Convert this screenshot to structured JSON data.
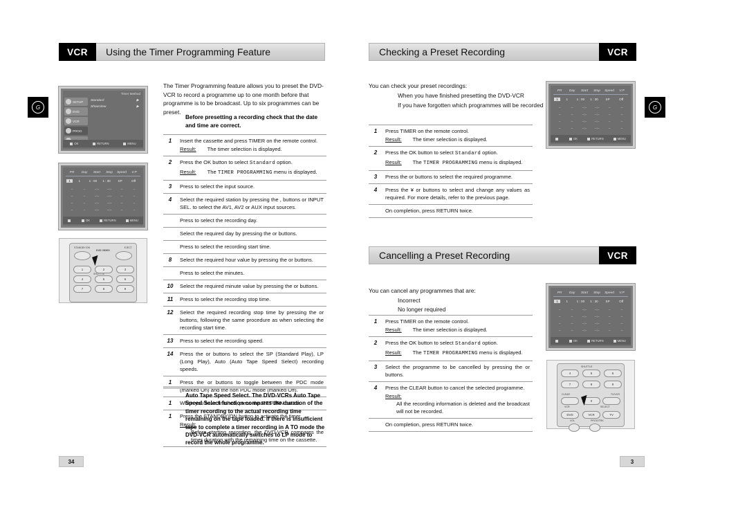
{
  "left_page": {
    "header": {
      "tag": "VCR",
      "title": "Using the Timer Programming Feature"
    },
    "intro": "The Timer Programming feature allows you to preset the DVD-VCR to record a programme up to one month before that programme is to be broadcast. Up to six programmes can be preset.",
    "note": "Before presetting a recording  check that the date and time are correct.",
    "steps": [
      {
        "num": "1",
        "text": "Insert the cassette and press TIMER on the remote control.",
        "result_label": "Result:",
        "result": "The timer selection is displayed."
      },
      {
        "num": "2",
        "text": "Press the OK button to select Standard option.",
        "mono_in_text": "Standard",
        "result_label": "Result:",
        "result": "The TIMER PROGRAMMING menu is displayed.",
        "mono_in_result": "TIMER PROGRAMMING"
      },
      {
        "num": "3",
        "text": "Press  to select the input source."
      },
      {
        "num": "4",
        "text": "Select the required station by pressing the  ,  buttons or INPUT SEL. to select the  AV1, AV2 or AUX input sources."
      },
      {
        "num": "",
        "text": "Press  to select the recording day."
      },
      {
        "num": "",
        "text": "Select the required day by pressing the  or  buttons."
      },
      {
        "num": "",
        "text": "Press  to select the recording start time."
      },
      {
        "num": "8",
        "text": "Select the required hour value by pressing the  or  buttons."
      },
      {
        "num": "",
        "text": "Press  to select the minutes."
      },
      {
        "num": "10",
        "text": "Select the required minute value by pressing the  or buttons."
      },
      {
        "num": "11",
        "text": "Press  to select the recording stop time."
      },
      {
        "num": "12",
        "text": "Select the required recording stop time by pressing the  or buttons, following the same procedure as when selecting the recording start time."
      },
      {
        "num": "13",
        "text": "Press  to select the recording speed."
      },
      {
        "num": "14",
        "text": "Press the  or  buttons to select the SP (Standard Play), LP (Long Play), Auto (Auto Tape Speed Select) recording speeds."
      },
      {
        "num": "1",
        "text": "Press the  or  buttons to toggle between the PDC mode (marked On) and the non PDC mode (marked Off)."
      },
      {
        "num": "1",
        "text": "When you have finished, press the RETURN button."
      },
      {
        "num": "1",
        "text": "Press the STANDBY/ON button to activate the timer.",
        "result_label": "Result:",
        "result": "Before starting recording, the DVD-VCR compares the timer duration with the remaining time on the cassette."
      }
    ],
    "tip": "Auto Tape Speed Select. The DVD-VCRs Auto Tape Speed Select function compares the duration of the timer recording to the actual recording time remaining on the tape loaded. If there is insufficient tape to complete a timer recording in A  TO mode  the DVD-VCR automatically switches to LP mode to record the whole programme.",
    "page_number": "34",
    "margin_mark": "G",
    "osd_setup": {
      "title": "Timer Method",
      "sidebar": [
        "SETUP",
        "DVD",
        "VCR",
        "PROG",
        "FUNC"
      ],
      "active_item": "PROG",
      "menu_items": [
        "Standard",
        "ShowView"
      ],
      "footer": [
        "OK",
        "RETURN",
        "MENU"
      ]
    },
    "osd_timer": {
      "columns": [
        "PR",
        "Day",
        "Start",
        "Stop",
        "Speed",
        "V.P"
      ],
      "selected_row": [
        "1",
        "1",
        "1 : 00",
        "1 : 30",
        "SP",
        "Off"
      ],
      "empty_row": [
        "--",
        "--",
        "--:--",
        "--:--",
        "--",
        "--"
      ],
      "empty_row_count": 4,
      "footer": [
        "OK",
        "RETURN",
        "MENU"
      ]
    },
    "remote": {
      "label_left": "STANDBY/ON",
      "label_right": "EJECT",
      "logo": "DVD VIDEO",
      "shuttle_label": "SHUTTLE",
      "keys": [
        "1",
        "2",
        "3",
        "4",
        "5",
        "6",
        "7",
        "8",
        "9"
      ]
    }
  },
  "right_page": {
    "section_check": {
      "header": {
        "tag": "VCR",
        "title": "Checking a Preset Recording"
      },
      "intro": "You can check your preset recordings:",
      "bullets": [
        "When you have finished presetting the DVD-VCR",
        "If you have forgotten which programmes will be recorded"
      ],
      "steps": [
        {
          "num": "1",
          "text": "Press TIMER on the remote control.",
          "result_label": "Result:",
          "result": "The timer selection is displayed."
        },
        {
          "num": "2",
          "text": "Press the OK button to select Standard option.",
          "mono_in_text": "Standard",
          "result_label": "Result:",
          "result": "The TIMER PROGRAMMING menu is displayed.",
          "mono_in_result": "TIMER PROGRAMMING"
        },
        {
          "num": "3",
          "text": "Press the  or  buttons to select the required programme."
        },
        {
          "num": "4",
          "text": "Press the ¥ or  buttons to select and change any values as required. For more details, refer to the previous page."
        },
        {
          "num": "",
          "text": "On completion, press RETURN twice."
        }
      ]
    },
    "section_cancel": {
      "header": {
        "tag": "VCR",
        "title": "Cancelling a Preset Recording"
      },
      "intro": "You can cancel any programmes that are:",
      "bullets": [
        "Incorrect",
        "No longer required"
      ],
      "steps": [
        {
          "num": "1",
          "text": "Press TIMER on the remote control.",
          "result_label": "Result:",
          "result": "The timer selection is displayed."
        },
        {
          "num": "2",
          "text": "Press the OK button to select Standard option.",
          "mono_in_text": "Standard",
          "result_label": "Result:",
          "result": "The TIMER PROGRAMMING menu is displayed.",
          "mono_in_result": "TIMER PROGRAMMING"
        },
        {
          "num": "3",
          "text": "Select the programme to be cancelled by pressing the  or buttons."
        },
        {
          "num": "4",
          "text": "Press the CLEAR button to cancel the selected programme.",
          "result_label": "Result:",
          "result": "All the recording information is deleted and the broadcast will not be recorded."
        },
        {
          "num": "",
          "text": "On completion, press RETURN twice."
        }
      ]
    },
    "page_number": "3",
    "margin_mark": "G",
    "osd_timer": {
      "columns": [
        "PR",
        "Day",
        "Start",
        "Stop",
        "Speed",
        "V.P"
      ],
      "selected_row": [
        "1",
        "1",
        "1 : 00",
        "1 : 30",
        "SP",
        "Off"
      ],
      "empty_row": [
        "--",
        "--",
        "--:--",
        "--:--",
        "--",
        "--"
      ],
      "empty_row_count": 4,
      "footer": [
        "OK",
        "RETURN",
        "MENU"
      ]
    },
    "remote": {
      "shuttle_label": "SHUTTLE",
      "keys": [
        "4",
        "5",
        "6",
        "7",
        "8",
        "9"
      ],
      "clear_label": "CLEAR",
      "tvvcr_label": "TV/VCR",
      "zero_key": "0",
      "vcr_select_left": "VCR",
      "vcr_select_right": "SELECT",
      "mode_keys": [
        "DVD",
        "VCR",
        "TV"
      ],
      "vol_label": "VOL",
      "prog_label": "PROG/TRK"
    }
  }
}
